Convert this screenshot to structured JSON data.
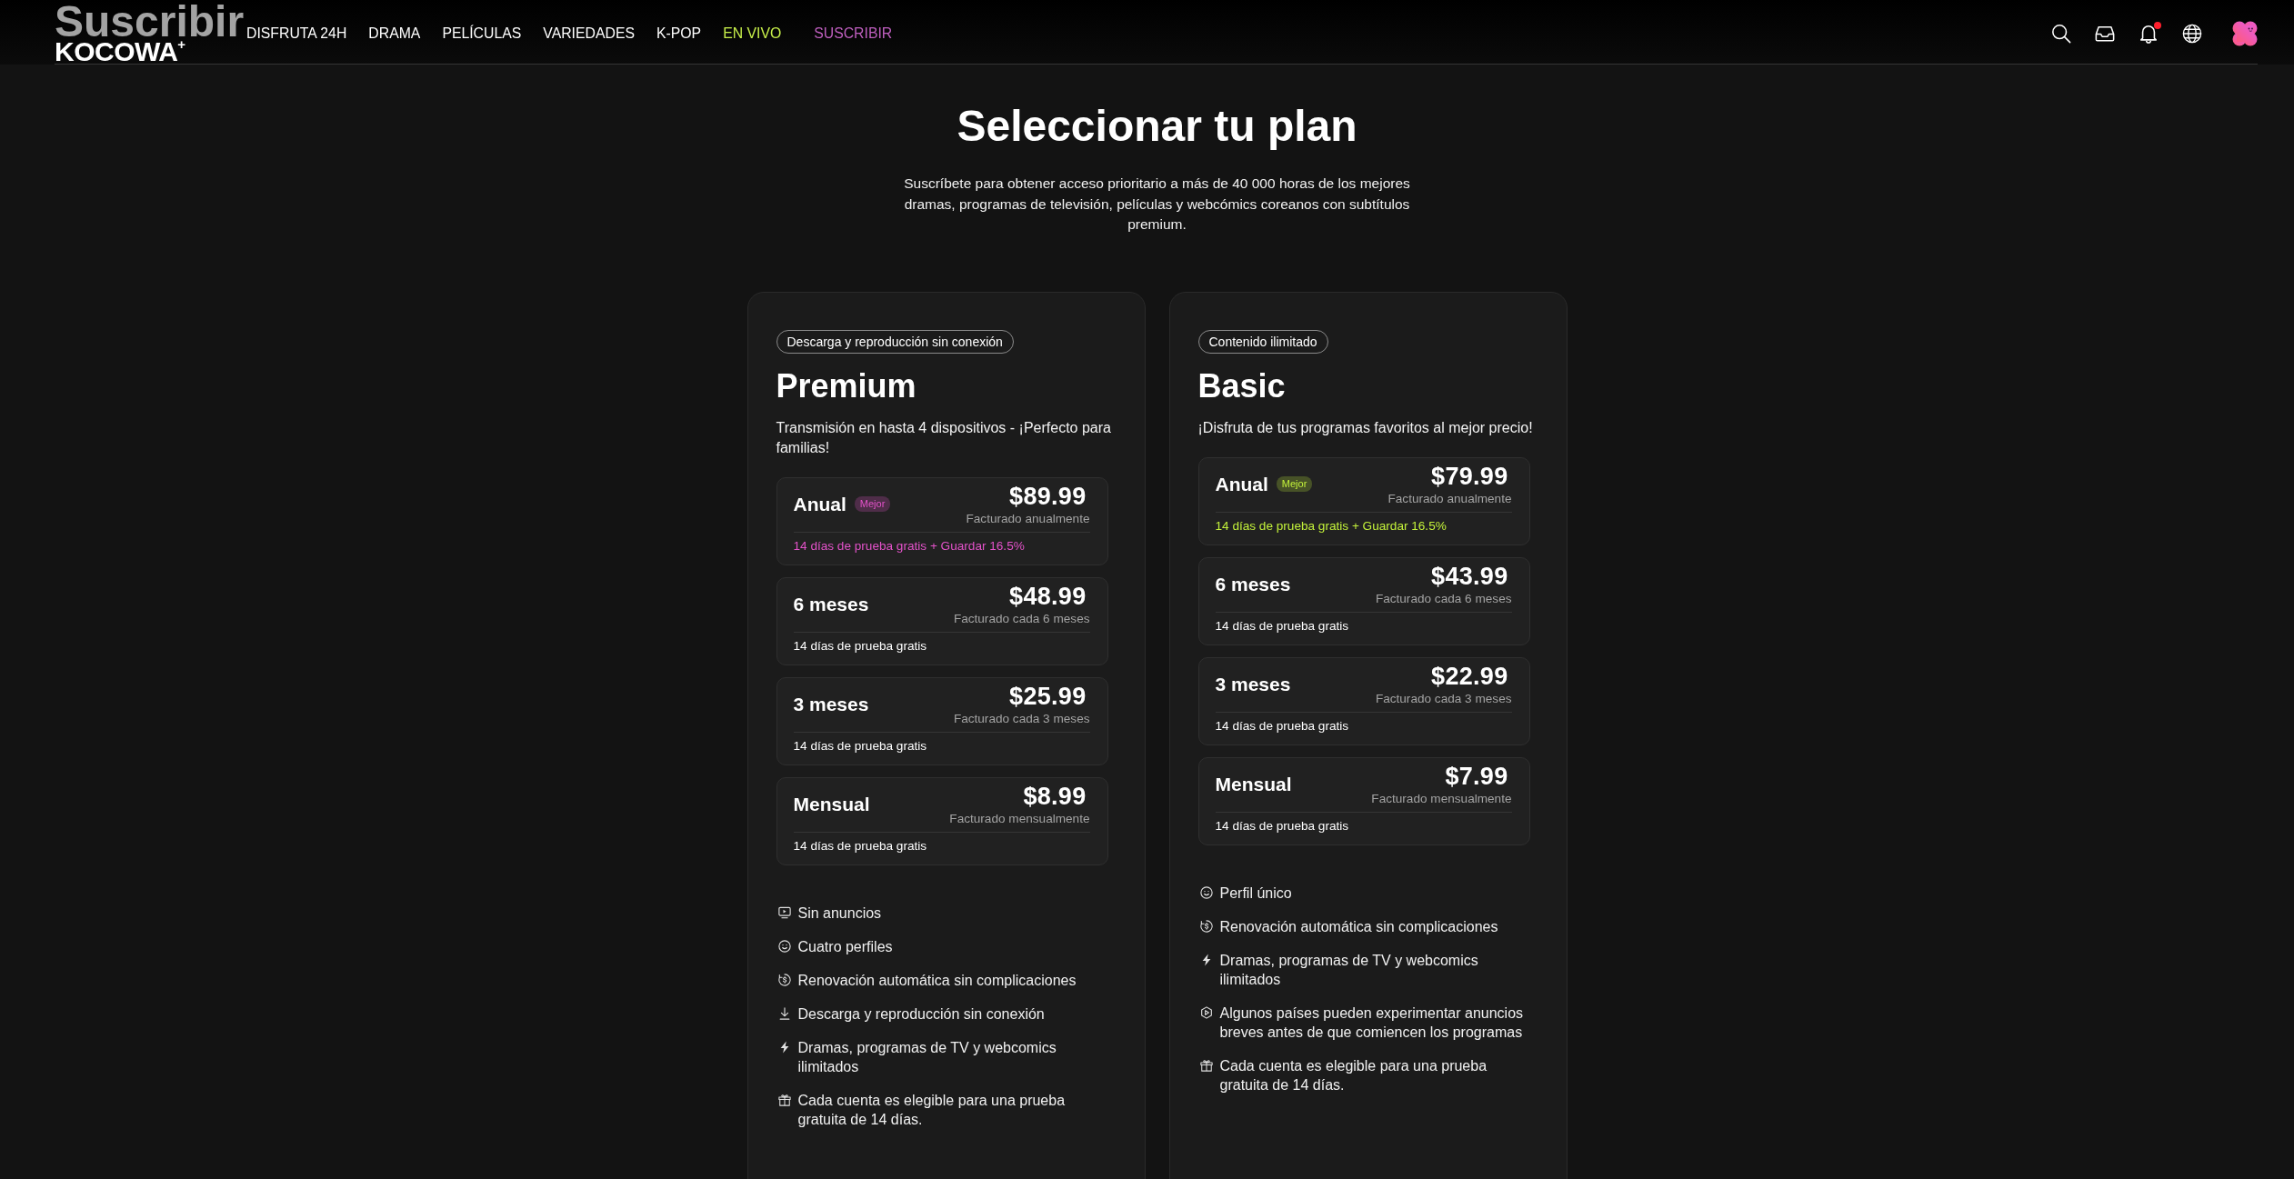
{
  "header": {
    "page_label": "Suscribir",
    "logo": "KOCOWA$^{+}$",
    "nav": [
      {
        "label": "DISFRUTA 24H",
        "kind": "link"
      },
      {
        "label": "DRAMA",
        "kind": "link"
      },
      {
        "label": "PELÍCULAS",
        "kind": "link"
      },
      {
        "label": "VARIEDADES",
        "kind": "link"
      },
      {
        "label": "K-POP",
        "kind": "link"
      },
      {
        "label": "EN VIVO",
        "kind": "live"
      },
      {
        "label": "SUSCRIBIR",
        "kind": "subscribe"
      }
    ],
    "unread_notifications": true
  },
  "title": "Seleccionar tu plan",
  "subtitle": "Suscríbete para obtener acceso prioritario a más de 40 000 horas de los mejores dramas, programas de televisión, películas y webcómics coreanos con subtítulos premium.",
  "plans": [
    {
      "tag": "Descarga y reproducción sin conexión",
      "name": "Premium",
      "description": "Transmisión en hasta 4 dispositivos - ¡Perfecto para familias!",
      "color": "#e352c9",
      "options": [
        {
          "period": "Anual",
          "badge": "Mejor",
          "price": "$89.99",
          "billing": "Facturado anualmente",
          "trial": "14 días de prueba gratis + Guardar 16.5%",
          "highlighted": true
        },
        {
          "period": "6 meses",
          "price": "$48.99",
          "billing": "Facturado cada 6 meses",
          "trial": "14 días de prueba gratis",
          "highlighted": false
        },
        {
          "period": "3 meses",
          "price": "$25.99",
          "billing": "Facturado cada 3 meses",
          "trial": "14 días de prueba gratis",
          "highlighted": false
        },
        {
          "period": "Mensual",
          "price": "$8.99",
          "billing": "Facturado mensualmente",
          "trial": "14 días de prueba gratis",
          "highlighted": false
        }
      ],
      "features": [
        {
          "kind": "noads",
          "text": "Sin anuncios"
        },
        {
          "kind": "profiles",
          "text": "Cuatro perfiles"
        },
        {
          "kind": "renewal",
          "text": "Renovación automática sin complicaciones"
        },
        {
          "kind": "offline",
          "text": "Descarga y reproducción sin conexión"
        },
        {
          "kind": "unlimited",
          "text": "Dramas, programas de TV y webcomics ilimitados"
        },
        {
          "kind": "trial",
          "text": "Cada cuenta es elegible para una prueba gratuita de 14 días."
        }
      ]
    },
    {
      "tag": "Contenido ilimitado",
      "name": "Basic",
      "description": "¡Disfruta de tus programas favoritos al mejor precio!",
      "color": "#c2f03a",
      "options": [
        {
          "period": "Anual",
          "badge": "Mejor",
          "price": "$79.99",
          "billing": "Facturado anualmente",
          "trial": "14 días de prueba gratis + Guardar 16.5%",
          "highlighted": true
        },
        {
          "period": "6 meses",
          "price": "$43.99",
          "billing": "Facturado cada 6 meses",
          "trial": "14 días de prueba gratis",
          "highlighted": false
        },
        {
          "period": "3 meses",
          "price": "$22.99",
          "billing": "Facturado cada 3 meses",
          "trial": "14 días de prueba gratis",
          "highlighted": false
        },
        {
          "period": "Mensual",
          "price": "$7.99",
          "billing": "Facturado mensualmente",
          "trial": "14 días de prueba gratis",
          "highlighted": false
        }
      ],
      "features": [
        {
          "kind": "profiles",
          "text": "Perfil único"
        },
        {
          "kind": "renewal",
          "text": "Renovación automática sin complicaciones"
        },
        {
          "kind": "unlimited",
          "text": "Dramas, programas de TV y webcomics ilimitados"
        },
        {
          "kind": "ads",
          "text": "Algunos países pueden experimentar anuncios breves antes de que comiencen los programas"
        },
        {
          "kind": "trial",
          "text": "Cada cuenta es elegible para una prueba gratuita de 14 días."
        }
      ]
    }
  ]
}
